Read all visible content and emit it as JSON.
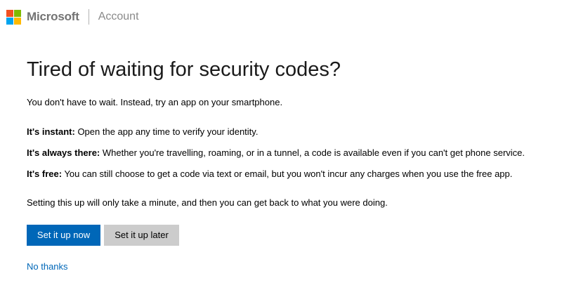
{
  "header": {
    "brand": "Microsoft",
    "section": "Account",
    "logo_colors": [
      "#f25022",
      "#7fba00",
      "#00a4ef",
      "#ffb900"
    ]
  },
  "main": {
    "title": "Tired of waiting for security codes?",
    "intro": "You don't have to wait. Instead, try an app on your smartphone.",
    "benefits": [
      {
        "label": "It's instant:",
        "text": " Open the app any time to verify your identity."
      },
      {
        "label": "It's always there:",
        "text": " Whether you're travelling, roaming, or in a tunnel, a code is available even if you can't get phone service."
      },
      {
        "label": "It's free:",
        "text": " You can still choose to get a code via text or email, but you won't incur any charges when you use the free app."
      }
    ],
    "setup_note": "Setting this up will only take a minute, and then you can get back to what you were doing.",
    "primary_button": "Set it up now",
    "secondary_button": "Set it up later",
    "no_thanks_link": "No thanks"
  },
  "colors": {
    "accent": "#0067b8",
    "secondary_button_bg": "#cccccc"
  }
}
